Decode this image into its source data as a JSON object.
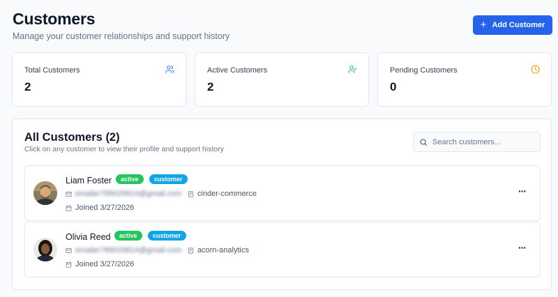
{
  "header": {
    "title": "Customers",
    "subtitle": "Manage your customer relationships and support history",
    "add_button": "Add Customer"
  },
  "stats": [
    {
      "label": "Total Customers",
      "value": "2",
      "icon": "users-icon",
      "color": "#3b82f6"
    },
    {
      "label": "Active Customers",
      "value": "2",
      "icon": "user-check-icon",
      "color": "#22c55e"
    },
    {
      "label": "Pending Customers",
      "value": "0",
      "icon": "clock-icon",
      "color": "#f59e0b"
    }
  ],
  "list": {
    "title": "All Customers (2)",
    "subtitle": "Click on any customer to view their profile and support history",
    "search_placeholder": "Search customers...",
    "customers": [
      {
        "name": "Liam Foster",
        "status": "active",
        "role": "customer",
        "email": "emailer789029814@gmail.com",
        "org": "cinder-commerce",
        "joined": "Joined 3/27/2026"
      },
      {
        "name": "Olivia Reed",
        "status": "active",
        "role": "customer",
        "email": "emailer789029814@gmail.com",
        "org": "acorn-analytics",
        "joined": "Joined 3/27/2026"
      }
    ]
  },
  "colors": {
    "accent": "#2563eb",
    "active_badge": "#22c55e",
    "role_badge": "#0ea5e9"
  }
}
